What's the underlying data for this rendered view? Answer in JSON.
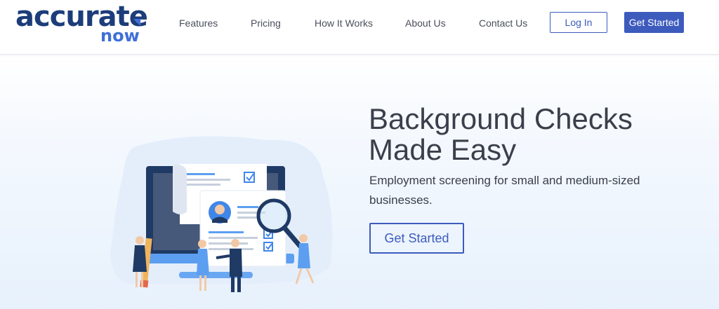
{
  "brand": {
    "name": "accurate",
    "sub": "now",
    "primary_color": "#1d3d7a",
    "accent_color": "#3f6fd8"
  },
  "nav": {
    "items": [
      {
        "label": "Features"
      },
      {
        "label": "Pricing"
      },
      {
        "label": "How It Works"
      },
      {
        "label": "About Us"
      },
      {
        "label": "Contact Us"
      }
    ],
    "login_label": "Log In",
    "get_started_label": "Get Started",
    "button_color": "#3d5bbd"
  },
  "hero": {
    "title_line1": "Background Checks",
    "title_line2": "Made Easy",
    "subtitle": "Employment screening for small and medium-sized businesses.",
    "cta_label": "Get Started"
  },
  "illustration": {
    "icons": [
      "laptop-icon",
      "resume-document-icon",
      "magnifying-glass-icon",
      "checkbox-icon",
      "pencil-icon",
      "person-icon"
    ]
  }
}
